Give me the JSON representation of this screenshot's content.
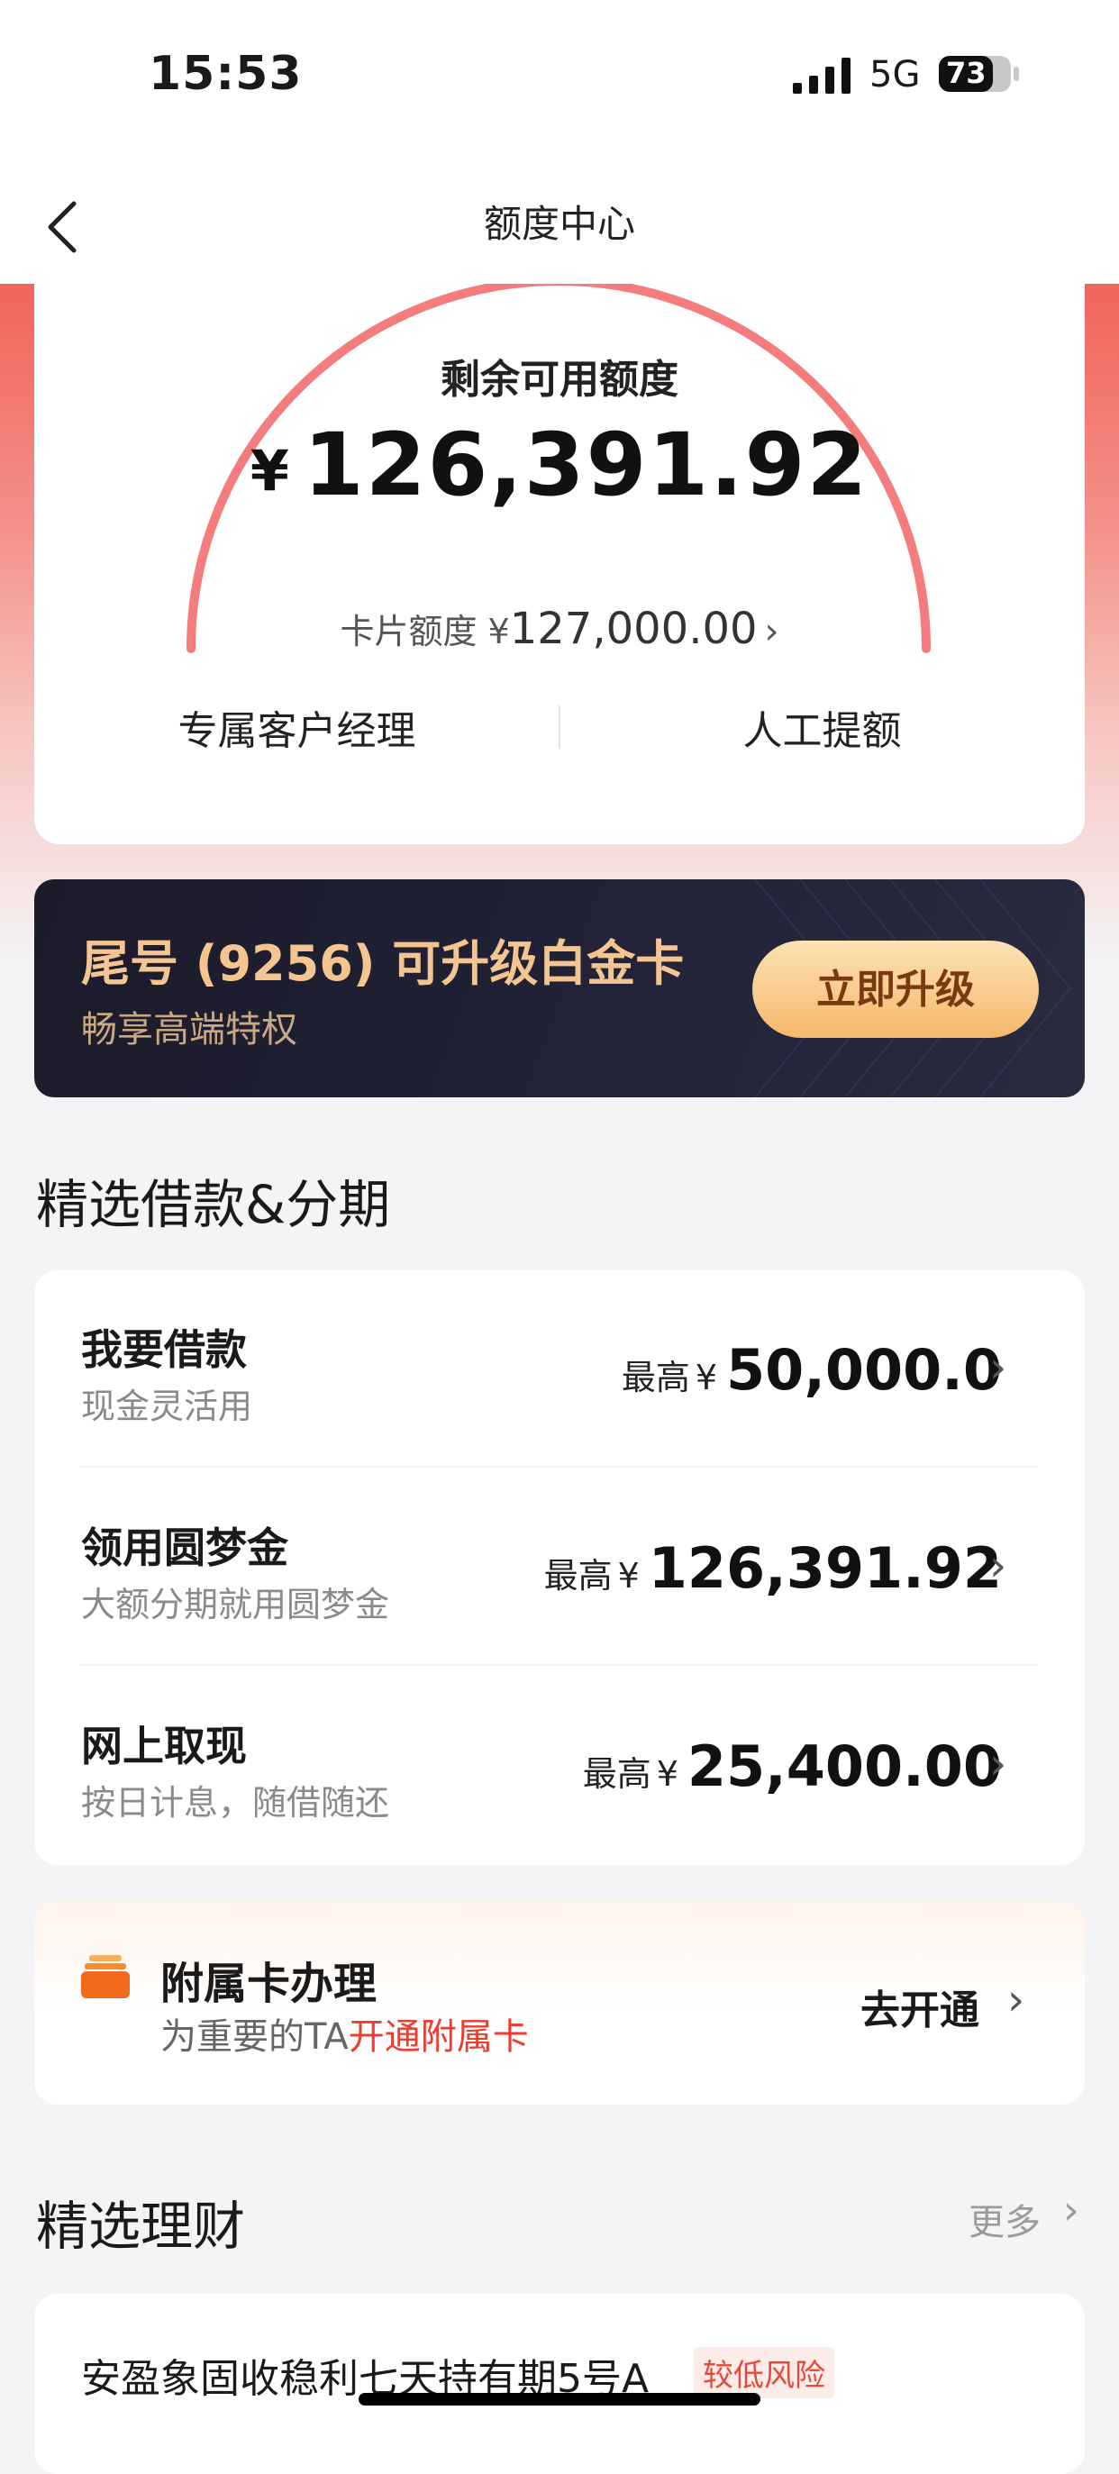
{
  "status_bar": {
    "time": "15:53",
    "network": "5G",
    "battery": "73"
  },
  "nav": {
    "title": "额度中心"
  },
  "credit": {
    "remaining_label": "剩余可用额度",
    "currency": "¥",
    "remaining_amount": "126,391.92",
    "card_limit_label": "卡片额度 ¥",
    "card_limit_value": "127,000.00",
    "links": [
      "专属客户经理",
      "人工提额"
    ]
  },
  "upgrade": {
    "title": "尾号 (9256) 可升级白金卡",
    "subtitle": "畅享高端特权",
    "button": "立即升级"
  },
  "loan_section": {
    "title": "精选借款&分期",
    "rows": [
      {
        "title": "我要借款",
        "subtitle": "现金灵活用",
        "prefix": "最高",
        "currency": "¥",
        "amount": "50,000.0"
      },
      {
        "title": "领用圆梦金",
        "subtitle": "大额分期就用圆梦金",
        "prefix": "最高",
        "currency": "¥",
        "amount": "126,391.92"
      },
      {
        "title": "网上取现",
        "subtitle": "按日计息，随借随还",
        "prefix": "最高",
        "currency": "¥",
        "amount": "25,400.00"
      }
    ]
  },
  "supplementary": {
    "icon": "card-stack-icon",
    "title": "附属卡办理",
    "subtitle_prefix": "为重要的TA",
    "subtitle_highlight": "开通附属卡",
    "action": "去开通"
  },
  "finance_section": {
    "title": "精选理财",
    "more": "更多",
    "product_name": "安盈象固收稳利七天持有期5号A",
    "risk_tag": "较低风险"
  },
  "colors": {
    "accent_red": "#ef3a2e",
    "gauge": "#f47c7c",
    "gold": "#f4c591"
  }
}
